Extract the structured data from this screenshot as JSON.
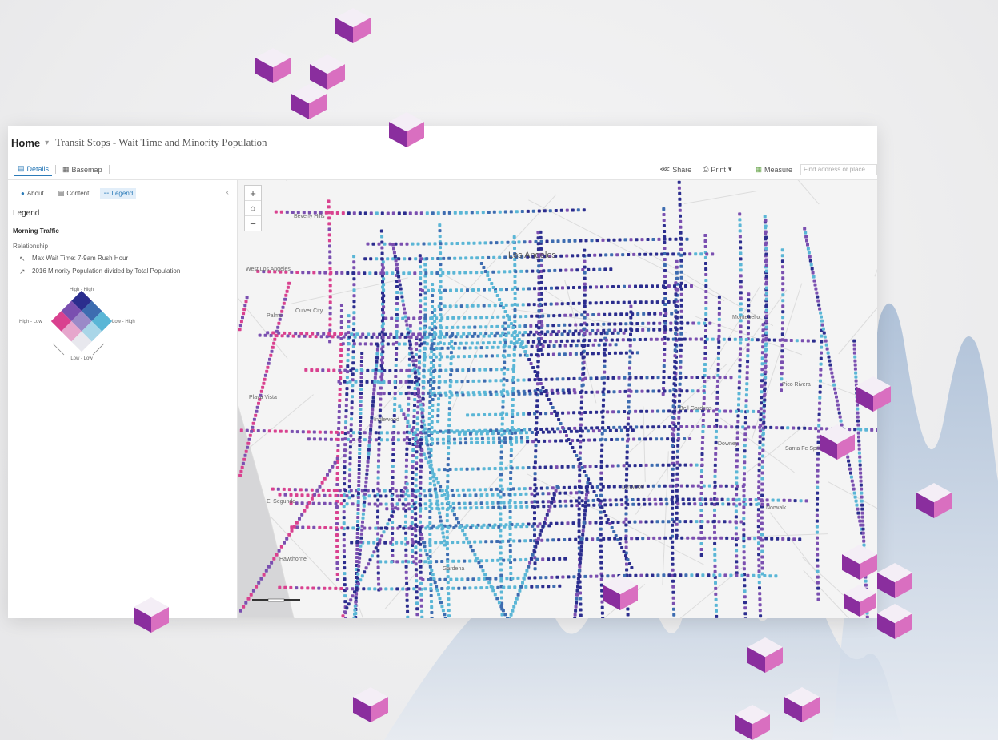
{
  "header": {
    "home": "Home",
    "title": "Transit Stops - Wait Time and Minority Population"
  },
  "toolbar": {
    "details": "Details",
    "basemap": "Basemap",
    "share": "Share",
    "print": "Print",
    "measure": "Measure",
    "search_placeholder": "Find address or place"
  },
  "sidebar": {
    "tabs": [
      "About",
      "Content",
      "Legend"
    ],
    "active_tab": "Legend",
    "heading": "Legend",
    "layer": "Morning Traffic",
    "relationship": "Relationship",
    "var1": "Max Wait Time: 7-9am Rush Hour",
    "var2": "2016 Minority Population divided by Total Population",
    "legend_labels": {
      "top": "High - High",
      "left": "High - Low",
      "right": "Low - High",
      "bottom": "Low - Low"
    }
  },
  "map": {
    "places": [
      "Los Angeles",
      "Beverly Hills",
      "West Los Angeles",
      "Culver City",
      "Palms",
      "Playa Vista",
      "El Segundo",
      "Hawthorne",
      "Gardena",
      "Montebello",
      "Pico Rivera",
      "Santa Fe Springs",
      "Norwalk",
      "Bell Gardens",
      "Downey",
      "Lynwood",
      "Inglewood"
    ]
  },
  "colors": {
    "accent": "#2a7ab8",
    "high_high": "#2b2d8e",
    "high_low": "#d9418f",
    "low_high": "#5ab6d6",
    "low_low": "#e8e8ee",
    "mid": "#7a4fb0"
  }
}
